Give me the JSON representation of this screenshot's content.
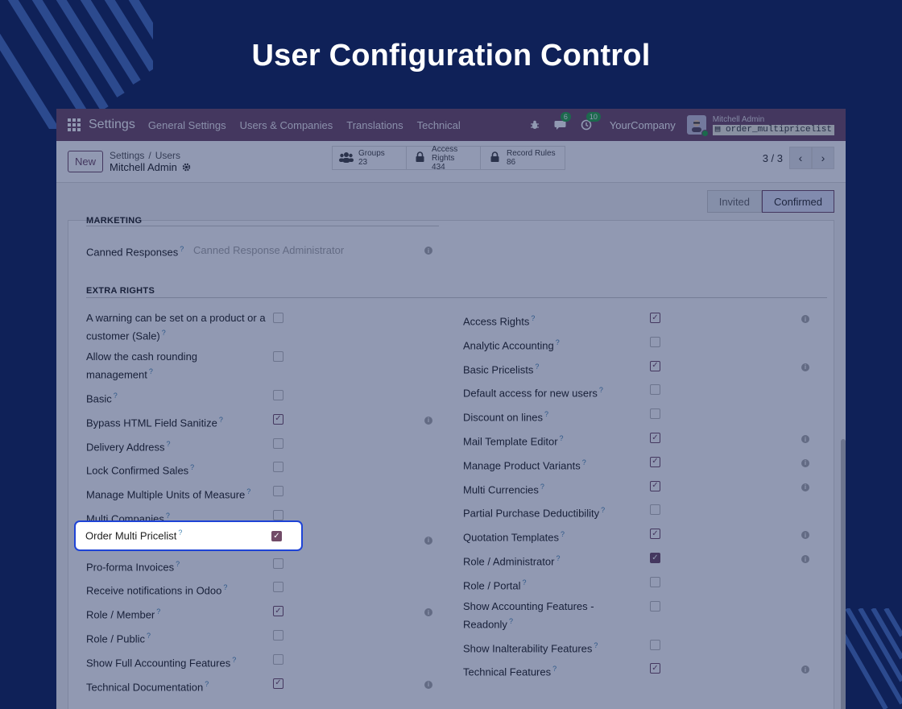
{
  "headline": "User Configuration Control",
  "navbar": {
    "brand": "Settings",
    "menu": [
      "General Settings",
      "Users & Companies",
      "Translations",
      "Technical"
    ],
    "messages_count": "6",
    "activities_count": "10",
    "company": "YourCompany",
    "user_name": "Mitchell Admin",
    "database": "order_multipricelist"
  },
  "control": {
    "new_label": "New",
    "breadcrumb": [
      "Settings",
      "Users"
    ],
    "record_title": "Mitchell Admin",
    "smart_buttons": [
      {
        "label": "Groups",
        "value": "23",
        "icon": "users-icon"
      },
      {
        "label": "Access Rights",
        "value": "434",
        "icon": "lock-icon"
      },
      {
        "label": "Record Rules",
        "value": "86",
        "icon": "lock-icon"
      }
    ],
    "pager": "3 / 3"
  },
  "status": {
    "stages": [
      "Invited",
      "Confirmed"
    ],
    "current": "Confirmed"
  },
  "marketing": {
    "title": "MARKETING",
    "canned_label": "Canned Responses",
    "canned_value": "Canned Response Administrator"
  },
  "extra_rights": {
    "title": "EXTRA RIGHTS",
    "left": [
      {
        "label": "A warning can be set on a product or a",
        "label2": "customer (Sale)",
        "checked": false,
        "info": false
      },
      {
        "label": "Allow the cash rounding",
        "label2": "management",
        "checked": false,
        "info": false
      },
      {
        "label": "Basic",
        "checked": false,
        "info": false
      },
      {
        "label": "Bypass HTML Field Sanitize",
        "checked": true,
        "info": true
      },
      {
        "label": "Delivery Address",
        "checked": false,
        "info": false
      },
      {
        "label": "Lock Confirmed Sales",
        "checked": false,
        "info": false
      },
      {
        "label": "Manage Multiple Units of Measure",
        "checked": false,
        "info": false
      },
      {
        "label": "Multi Companies",
        "checked": false,
        "info": false
      },
      {
        "label": "Order Multi Pricelist",
        "checked": true,
        "info": true,
        "highlighted": true
      },
      {
        "label": "Pro-forma Invoices",
        "checked": false,
        "info": false
      },
      {
        "label": "Receive notifications in Odoo",
        "checked": false,
        "info": false
      },
      {
        "label": "Role / Member",
        "checked": true,
        "info": true
      },
      {
        "label": "Role / Public",
        "checked": false,
        "info": false
      },
      {
        "label": "Show Full Accounting Features",
        "checked": false,
        "info": false
      },
      {
        "label": "Technical Documentation",
        "checked": true,
        "info": true
      }
    ],
    "right": [
      {
        "label": "Access Rights",
        "checked": true,
        "info": true
      },
      {
        "label": "Analytic Accounting",
        "checked": false,
        "info": false
      },
      {
        "label": "Basic Pricelists",
        "checked": true,
        "info": true
      },
      {
        "label": "Default access for new users",
        "checked": false,
        "info": false
      },
      {
        "label": "Discount on lines",
        "checked": false,
        "info": false
      },
      {
        "label": "Mail Template Editor",
        "checked": true,
        "info": true
      },
      {
        "label": "Manage Product Variants",
        "checked": true,
        "info": true
      },
      {
        "label": "Multi Currencies",
        "checked": true,
        "info": true
      },
      {
        "label": "Partial Purchase Deductibility",
        "checked": false,
        "info": false
      },
      {
        "label": "Quotation Templates",
        "checked": true,
        "info": true
      },
      {
        "label": "Role / Administrator",
        "checked": true,
        "info": true,
        "solid": true
      },
      {
        "label": "Role / Portal",
        "checked": false,
        "info": false
      },
      {
        "label": "Show Accounting Features -",
        "label2": "Readonly",
        "checked": false,
        "info": false
      },
      {
        "label": "Show Inalterability Features",
        "checked": false,
        "info": false
      },
      {
        "label": "Technical Features",
        "checked": true,
        "info": true
      }
    ]
  },
  "help_mark": "?",
  "info_mark": "i",
  "check_mark": "✓",
  "colors": {
    "background": "#0f2158",
    "brand": "#714b67",
    "highlight": "#1e43d6"
  }
}
